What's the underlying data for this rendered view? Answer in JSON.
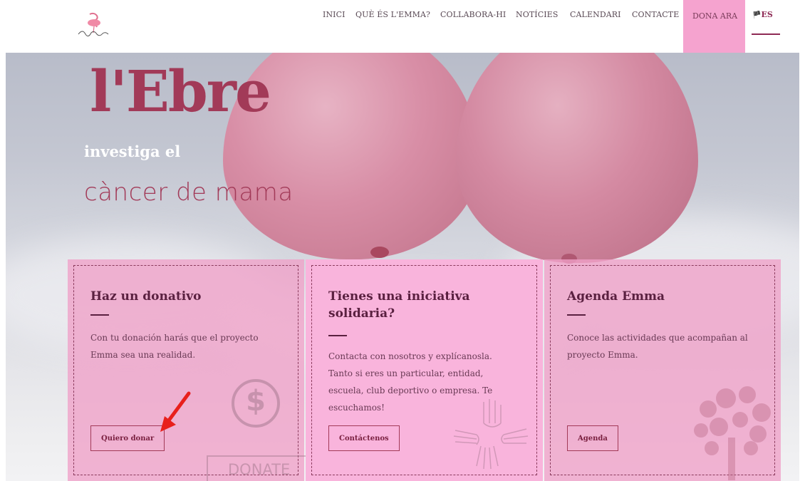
{
  "nav": {
    "items": [
      "INICI",
      "QUÈ ÉS L'EMMA?",
      "COLLABORA-HI",
      "NOTÍCIES",
      "CALENDARI",
      "CONTACTE"
    ],
    "dona_label": "DONA ARA",
    "lang_label": "ES"
  },
  "hero": {
    "title": "l'Ebre",
    "subtitle": "investiga el",
    "subtitle2": "càncer de mama"
  },
  "cards": [
    {
      "title": "Haz un donativo",
      "text": "Con tu donación harás que el proyecto Emma sea una realidad.",
      "button": "Quiero donar",
      "deco_text": "DONATE"
    },
    {
      "title": "Tienes una iniciativa solidaria?",
      "text": "Contacta con nosotros y explícanosla. Tanto si eres un particular, entidad, escuela, club deportivo o empresa. Te escuchamos!",
      "button": "Contáctenos"
    },
    {
      "title": "Agenda Emma",
      "text": "Conoce las actividades que acompañan al proyecto Emma.",
      "button": "Agenda"
    }
  ],
  "colors": {
    "accent": "#a23a58",
    "dona_bg": "#f5a3cf",
    "card_bg": "#f9b4dc"
  }
}
